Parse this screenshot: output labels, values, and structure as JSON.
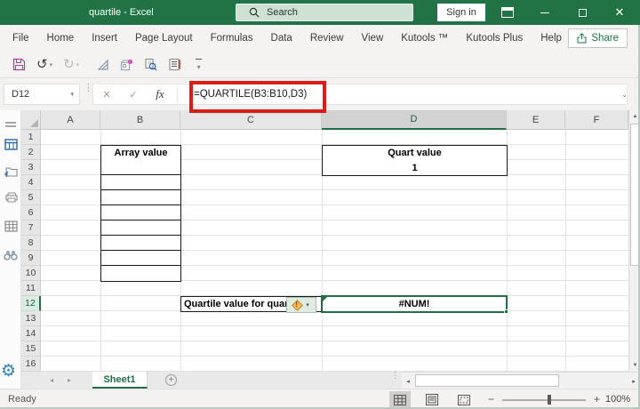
{
  "window": {
    "title": "quartile  -  Excel",
    "search_placeholder": "Search",
    "sign_in_label": "Sign in"
  },
  "ribbon": {
    "tabs": [
      "File",
      "Home",
      "Insert",
      "Page Layout",
      "Formulas",
      "Data",
      "Review",
      "View",
      "Kutools ™",
      "Kutools Plus",
      "Help"
    ],
    "share_label": "Share"
  },
  "quick_access": {
    "icons": [
      "save",
      "undo",
      "redo",
      "draft",
      "package",
      "print-preview",
      "notes",
      "customize-toolbar"
    ]
  },
  "formula_bar": {
    "name_box": "D12",
    "fx_label": "fx",
    "formula": "=QUARTILE(B3:B10,D3)"
  },
  "grid": {
    "columns": [
      "A",
      "B",
      "C",
      "D",
      "E",
      "F"
    ],
    "rows": [
      "1",
      "2",
      "3",
      "4",
      "5",
      "6",
      "7",
      "8",
      "9",
      "10",
      "11",
      "12",
      "13",
      "14",
      "15",
      "16"
    ],
    "selected_column": "D",
    "selected_row": "12",
    "selected_cell": "D12",
    "cells": {
      "b2": "Array value",
      "d2": "Quart value",
      "d3": "1",
      "c12": "Quartile value for quart",
      "d12_error": "#NUM!"
    }
  },
  "sheet_bar": {
    "active_tab": "Sheet1"
  },
  "status_bar": {
    "mode": "Ready",
    "zoom_level": "100%"
  },
  "colors": {
    "titlebar_green": "#217346",
    "accent_green": "#1e7145",
    "annotation_red": "#dc1d16",
    "error_button_bg": "#dfeae1",
    "selected_header_bg": "#d2d2d2"
  }
}
